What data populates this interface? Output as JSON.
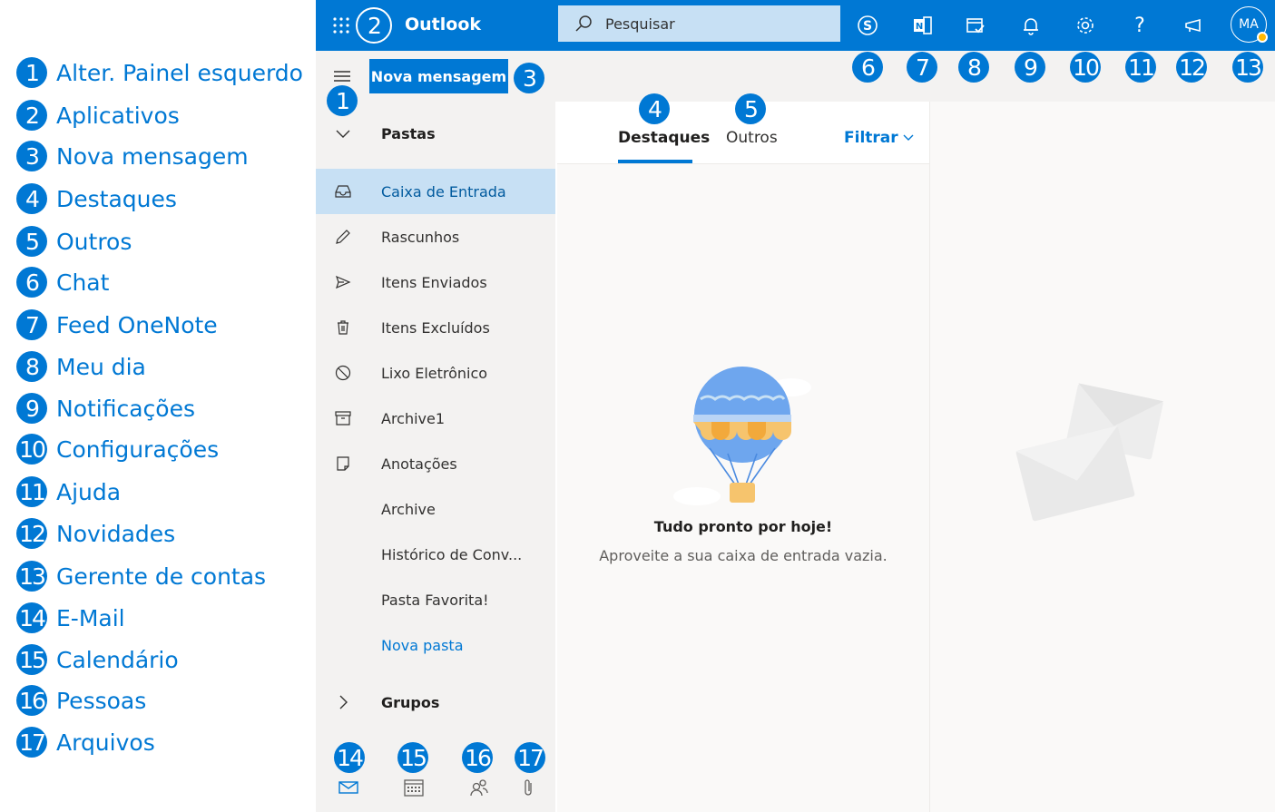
{
  "legend": [
    {
      "num": "1",
      "label": "Alter. Painel esquerdo"
    },
    {
      "num": "2",
      "label": "Aplicativos"
    },
    {
      "num": "3",
      "label": "Nova mensagem"
    },
    {
      "num": "4",
      "label": "Destaques"
    },
    {
      "num": "5",
      "label": "Outros"
    },
    {
      "num": "6",
      "label": "Chat"
    },
    {
      "num": "7",
      "label": "Feed OneNote"
    },
    {
      "num": "8",
      "label": "Meu dia"
    },
    {
      "num": "9",
      "label": "Notificações"
    },
    {
      "num": "10",
      "label": "Configurações"
    },
    {
      "num": "11",
      "label": "Ajuda"
    },
    {
      "num": "12",
      "label": "Novidades"
    },
    {
      "num": "13",
      "label": "Gerente de contas"
    },
    {
      "num": "14",
      "label": "E-Mail"
    },
    {
      "num": "15",
      "label": "Calendário"
    },
    {
      "num": "16",
      "label": "Pessoas"
    },
    {
      "num": "17",
      "label": "Arquivos"
    }
  ],
  "topbar": {
    "app_name": "Outlook",
    "search_placeholder": "Pesquisar",
    "avatar_initials": "MA"
  },
  "cmdbar": {
    "new_message_label": "Nova mensagem"
  },
  "folders": {
    "header_label": "Pastas",
    "items": [
      {
        "label": "Caixa de Entrada",
        "icon": "inbox-icon",
        "selected": true
      },
      {
        "label": "Rascunhos",
        "icon": "pencil-icon"
      },
      {
        "label": "Itens Enviados",
        "icon": "send-icon"
      },
      {
        "label": "Itens Excluídos",
        "icon": "trash-icon"
      },
      {
        "label": "Lixo Eletrônico",
        "icon": "block-icon"
      },
      {
        "label": "Archive1",
        "icon": "archive-icon"
      },
      {
        "label": "Anotações",
        "icon": "note-icon"
      },
      {
        "label": "Archive",
        "icon": ""
      },
      {
        "label": "Histórico de Conv...",
        "icon": ""
      },
      {
        "label": "Pasta Favorita!",
        "icon": ""
      }
    ],
    "new_folder_label": "Nova pasta",
    "groups_label": "Grupos"
  },
  "msglist": {
    "tabs": [
      "Destaques",
      "Outros"
    ],
    "filter_label": "Filtrar",
    "empty_title": "Tudo pronto por hoje!",
    "empty_subtitle": "Aproveite a sua caixa de entrada vazia."
  },
  "badges": {
    "b1": "1",
    "b2": "2",
    "b3": "3",
    "b4": "4",
    "b5": "5",
    "b6": "6",
    "b7": "7",
    "b8": "8",
    "b9": "9",
    "b10": "10",
    "b11": "11",
    "b12": "12",
    "b13": "13",
    "b14": "14",
    "b15": "15",
    "b16": "16",
    "b17": "17"
  },
  "colors": {
    "brand": "#0078d4",
    "selected_folder": "#c7e0f4",
    "pane_bg": "#f3f2f1"
  }
}
